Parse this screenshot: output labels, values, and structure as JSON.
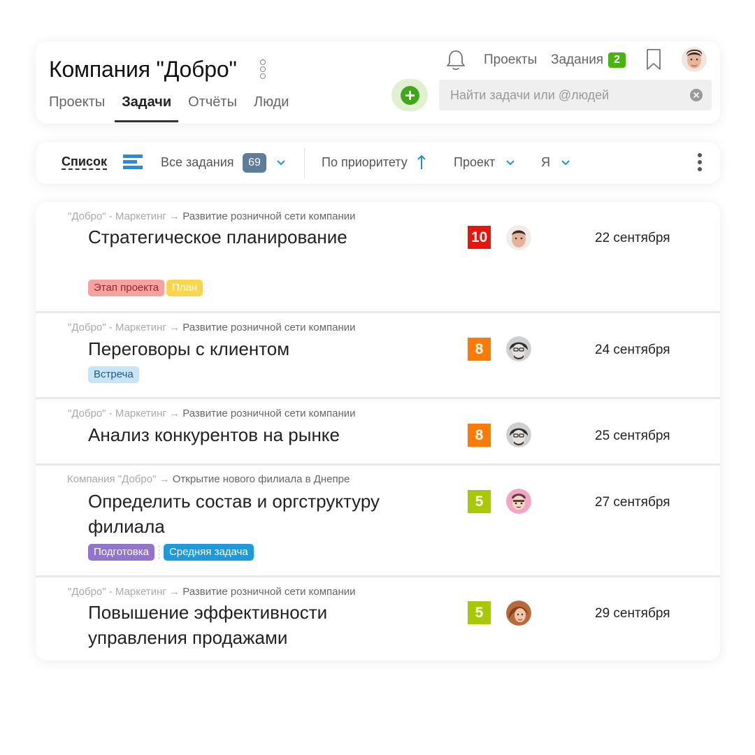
{
  "header": {
    "company_title": "Компания \"Добро\"",
    "tabs": [
      {
        "label": "Проекты",
        "active": false
      },
      {
        "label": "Задачи",
        "active": true
      },
      {
        "label": "Отчёты",
        "active": false
      },
      {
        "label": "Люди",
        "active": false
      }
    ],
    "top_links": {
      "projects": "Проекты",
      "tasks": "Задания",
      "tasks_count": "2"
    },
    "search_placeholder": "Найти задачи или @людей",
    "icons": {
      "notifications": "bell-icon",
      "bookmark": "bookmark-icon",
      "add": "plus-circle-icon",
      "clear": "clear-circle-icon"
    }
  },
  "toolbar": {
    "view": "Список",
    "filter": "Все задания",
    "filter_count": "69",
    "sort": "По приоритету",
    "project_filter": "Проект",
    "assignee_filter": "Я"
  },
  "colors": {
    "accent_green": "#49b40f",
    "accent_blue": "#1e8fe1",
    "priority_10": "#e8150e",
    "priority_8": "#ff7a00",
    "priority_5": "#a8c800"
  },
  "tasks": [
    {
      "path_company": "\"Добро\" - Маркетинг",
      "path_arrow": "→",
      "path_project": "Развитие розничной сети компании",
      "title": "Стратегическое планирование",
      "priority": "10",
      "due": "22 сентября",
      "tags": [
        {
          "label": "Этап проекта",
          "bg": "#f7a1a1",
          "fg": "#8a2a2a"
        },
        {
          "label": "План",
          "bg": "#fbd64a",
          "fg": "#ffffff"
        }
      ]
    },
    {
      "path_company": "\"Добро\" - Маркетинг",
      "path_arrow": "→",
      "path_project": "Развитие розничной сети компании",
      "title": "Переговоры с клиентом",
      "priority": "8",
      "due": "24 сентября",
      "tags": [
        {
          "label": "Встреча",
          "bg": "#c9e3f7",
          "fg": "#245a86"
        }
      ]
    },
    {
      "path_company": "\"Добро\" - Маркетинг",
      "path_arrow": "→",
      "path_project": "Развитие розничной сети компании",
      "title": "Анализ конкурентов на рынке",
      "priority": "8",
      "due": "25 сентября",
      "tags": []
    },
    {
      "path_company": "Компания \"Добро\"",
      "path_arrow": "→",
      "path_project": "Открытие нового филиала в Днепре",
      "title": "Определить состав и оргструктуру филиала",
      "priority": "5",
      "due": "27 сентября",
      "tags": [
        {
          "label": "Подготовка",
          "bg": "#9274c8",
          "fg": "#ffffff"
        },
        {
          "label": "Средняя задача",
          "bg": "#1f9ad8",
          "fg": "#ffffff"
        }
      ]
    },
    {
      "path_company": "\"Добро\" - Маркетинг",
      "path_arrow": "→",
      "path_project": "Развитие розничной сети компании",
      "title": "Повышение эффективности управления продажами",
      "priority": "5",
      "due": "29 сентября",
      "tags": []
    }
  ]
}
